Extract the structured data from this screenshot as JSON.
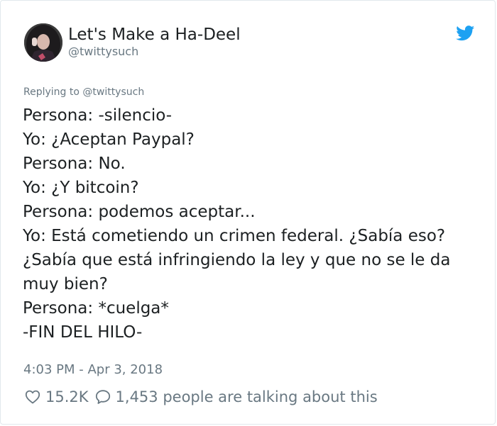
{
  "author": {
    "display_name": "Let's Make a Ha-Deel",
    "handle": "@twittysuch"
  },
  "replying_to": "Replying to @twittysuch",
  "tweet": {
    "lines": [
      "Persona: -silencio-",
      "Yo: ¿Aceptan Paypal?",
      "Persona: No.",
      "Yo: ¿Y bitcoin?",
      "Persona: podemos aceptar...",
      "Yo: Está cometiendo un crimen federal. ¿Sabía eso?",
      "¿Sabía que está infringiendo la ley y que no se le da",
      "muy bien?",
      "Persona: *cuelga*",
      "-FIN DEL HILO-"
    ]
  },
  "timestamp": "4:03 PM - Apr 3, 2018",
  "stats": {
    "likes": "15.2K",
    "talking": "1,453 people are talking about this"
  },
  "icons": {
    "brand": "twitter-bird-icon",
    "like": "heart-icon",
    "reply": "speech-bubble-icon"
  },
  "colors": {
    "brand": "#1da1f2",
    "text": "#1c2022",
    "muted": "#697882",
    "border": "#e1e8ed"
  }
}
